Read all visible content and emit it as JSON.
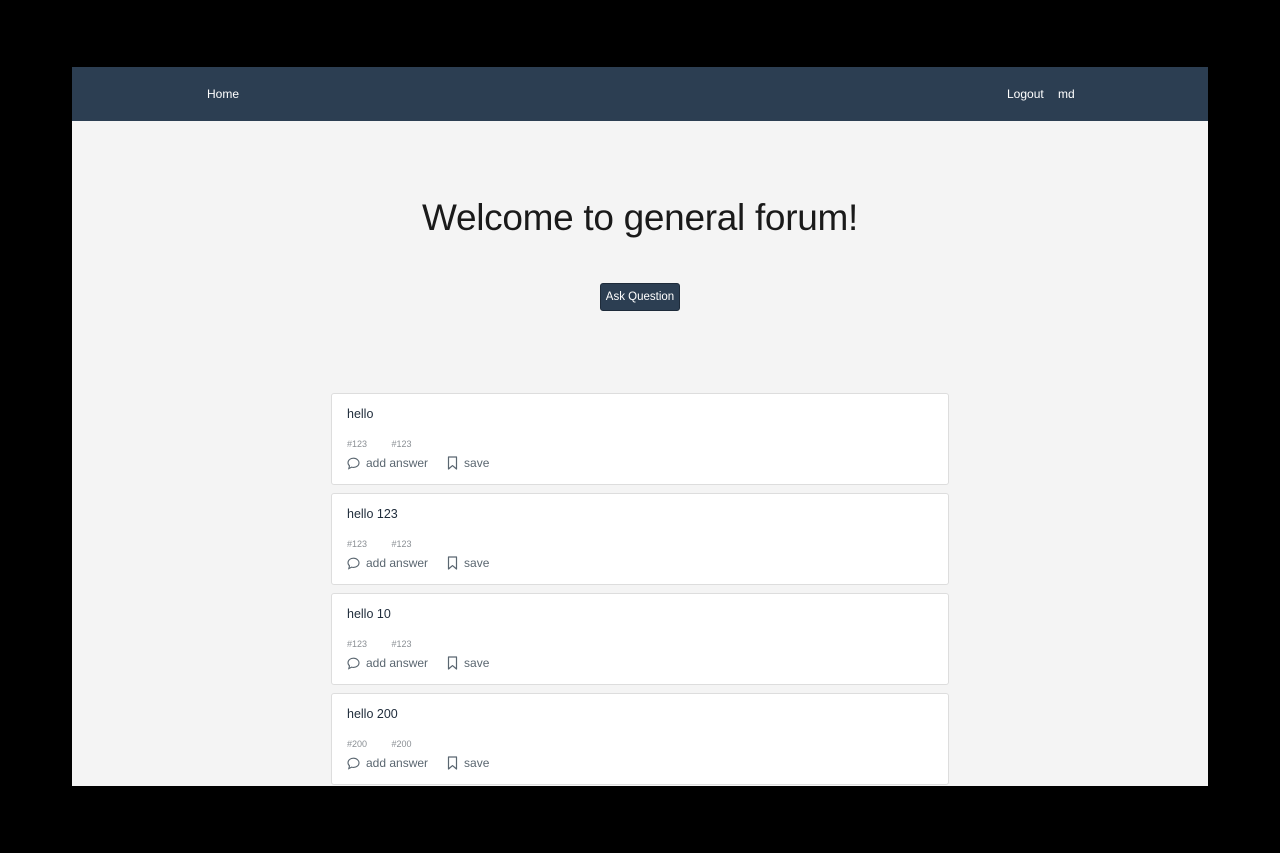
{
  "nav": {
    "home": "Home",
    "logout": "Logout",
    "user": "md"
  },
  "page": {
    "title": "Welcome to general forum!",
    "ask_button": "Ask Question"
  },
  "questions": [
    {
      "title": "hello",
      "tags": [
        "#123",
        "#123"
      ],
      "answer_label": "add answer",
      "save_label": "save"
    },
    {
      "title": "hello 123",
      "tags": [
        "#123",
        "#123"
      ],
      "answer_label": "add answer",
      "save_label": "save"
    },
    {
      "title": "hello 10",
      "tags": [
        "#123",
        "#123"
      ],
      "answer_label": "add answer",
      "save_label": "save"
    },
    {
      "title": "hello 200",
      "tags": [
        "#200",
        "#200"
      ],
      "answer_label": "add answer",
      "save_label": "save"
    }
  ],
  "icons": {
    "answer": "speech-bubble-icon",
    "save": "bookmark-icon"
  },
  "colors": {
    "navbar": "#2c3e52",
    "background": "#f4f4f4",
    "button": "#2c3e52"
  }
}
